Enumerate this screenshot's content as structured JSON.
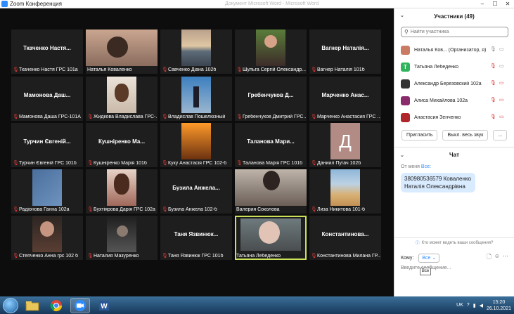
{
  "window": {
    "title": "Zoom Конференция",
    "ghost_title": "Документ Microsoft Word - Microsoft Word"
  },
  "tiles": [
    {
      "name": "Ткаченко Настя...",
      "label": "Ткаченко Настя ГРС 101а",
      "muted": true
    },
    {
      "name": "",
      "label": "Наталья Коваленко",
      "muted": false,
      "photo": "person"
    },
    {
      "name": "",
      "label": "Савченко Діана 102б",
      "muted": true,
      "photo": "sunset"
    },
    {
      "name": "",
      "label": "Шульга Сергій Олександр...",
      "muted": true,
      "photo": "guy"
    },
    {
      "name": "Вагнер Наталія...",
      "label": "Вагнер Наталія 101б",
      "muted": true
    },
    {
      "name": "Мамонова Даш...",
      "label": "Мамонова Даша ГРС-101А",
      "muted": true
    },
    {
      "name": "",
      "label": "Жидкова Владислава ГРС-...",
      "muted": true,
      "photo": "girl"
    },
    {
      "name": "",
      "label": "Владислав Пошелюзный",
      "muted": true,
      "photo": "blue"
    },
    {
      "name": "Гребенчуков Д...",
      "label": "Гребенчуков Дмитрий ГРС...",
      "muted": true
    },
    {
      "name": "Марченко Анас...",
      "label": "Марченко Анастасия ГРС ...",
      "muted": true
    },
    {
      "name": "Турчин Євгеній...",
      "label": "Турчин Євгеній ГРС 101б",
      "muted": true
    },
    {
      "name": "Кушніренко Ма...",
      "label": "Кушніренко Марія 101б",
      "muted": true
    },
    {
      "name": "",
      "label": "Куку Анастасія ГРС 102-б",
      "muted": true,
      "photo": "orange"
    },
    {
      "name": "Таланова Мари...",
      "label": "Таланова Марія ГРС 101б",
      "muted": true
    },
    {
      "name": "",
      "label": "Даниил Пугач 102б",
      "muted": true,
      "photo": "letterD"
    },
    {
      "name": "",
      "label": "Радіонова Ганна 102а",
      "muted": true,
      "photo": "blur"
    },
    {
      "name": "",
      "label": "Бухтіярова Дарія ГРС 102а",
      "muted": true,
      "photo": "girl2"
    },
    {
      "name": "Бузила Анжела...",
      "label": "Бузила Анжела 102-б",
      "muted": true
    },
    {
      "name": "",
      "label": "Валерия Соколова",
      "muted": false,
      "photo": "big"
    },
    {
      "name": "",
      "label": "Лиза Никитова 101-б",
      "muted": true,
      "photo": "beach"
    },
    {
      "name": "",
      "label": "Степченко Анна грс 102 б",
      "muted": true,
      "photo": "dark"
    },
    {
      "name": "",
      "label": "Наталия Мазуренко",
      "muted": true,
      "photo": "dark2"
    },
    {
      "name": "Таня Язвинюк...",
      "label": "Таня Язвинюк ГРС 101б",
      "muted": true
    },
    {
      "name": "",
      "label": "Татьяна Лебеденко",
      "muted": false,
      "photo": "older",
      "active": true
    },
    {
      "name": "Константинова...",
      "label": "Константинова Милана ГР...",
      "muted": true
    }
  ],
  "participants": {
    "title": "Участники (49)",
    "search_placeholder": "Найти участника",
    "list": [
      {
        "name": "Наталья Ков... (Организатор, я)",
        "avatar_color": "#c97b63",
        "avatar_letter": ""
      },
      {
        "name": "Татьяна Лебеденко",
        "avatar_color": "#2fb35b",
        "avatar_letter": "T"
      },
      {
        "name": "Александр Березовский 102а",
        "avatar_color": "#333333",
        "avatar_letter": ""
      },
      {
        "name": "Алиса Михайлова 102а",
        "avatar_color": "#8a2b6b",
        "avatar_letter": ""
      },
      {
        "name": "Анастасия Зенченко",
        "avatar_color": "#b0262a",
        "avatar_letter": ""
      }
    ],
    "invite": "Пригласить",
    "mute_all": "Выкл. весь звук",
    "more": "..."
  },
  "chat": {
    "title": "Чат",
    "from_label": "От меня",
    "to_label": "Все:",
    "message": "380980536579 Коваленко Наталія Олександрівна",
    "who_can_see": "Кто может видеть ваши сообщения?",
    "recipient_label": "Кому:",
    "recipient_value": "Все",
    "compose_placeholder": "Введите сообщение...",
    "tooltip": "Все"
  },
  "taskbar": {
    "lang": "UK",
    "time": "15:20",
    "date": "26.10.2021"
  }
}
